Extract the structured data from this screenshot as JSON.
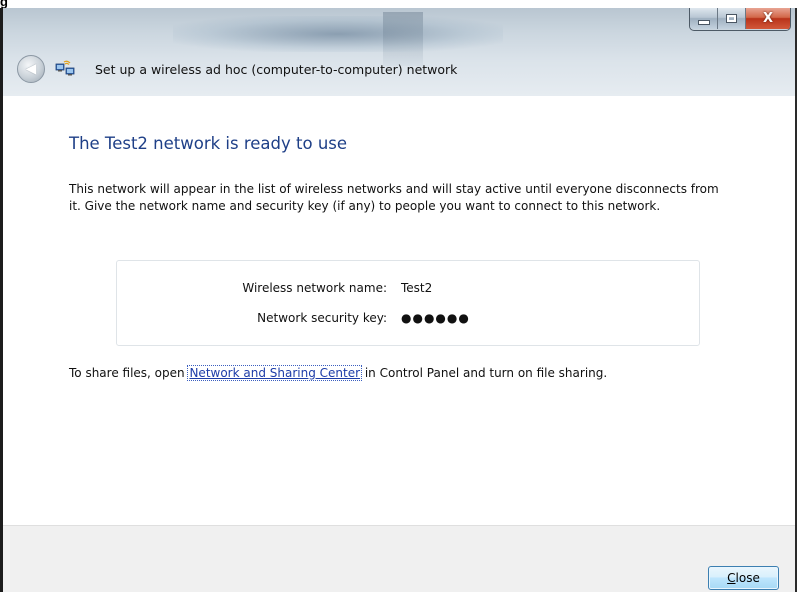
{
  "figure": {
    "caption_fragment": "g"
  },
  "window": {
    "title": "Set up a wireless ad hoc (computer-to-computer) network",
    "caption_buttons": {
      "minimize": "–",
      "maximize": "□",
      "close": "X"
    }
  },
  "content": {
    "heading": "The Test2 network is ready to use",
    "intro": "This network will appear in the list of wireless networks and will stay active until everyone disconnects from it. Give the network name and security key (if any) to people you want to connect to this network.",
    "details": {
      "name_label": "Wireless network name:",
      "name_value": "Test2",
      "key_label": "Network security key:",
      "key_value": "●●●●●●"
    },
    "share": {
      "before": "To share files, open ",
      "link": "Network and Sharing Center",
      "after": " in Control Panel and turn on file sharing."
    }
  },
  "footer": {
    "close_label": "C",
    "close_label_rest": "lose"
  },
  "colors": {
    "heading": "#1e3f87",
    "link": "#1d3ca8",
    "footer_bg": "#f0f0f0"
  }
}
